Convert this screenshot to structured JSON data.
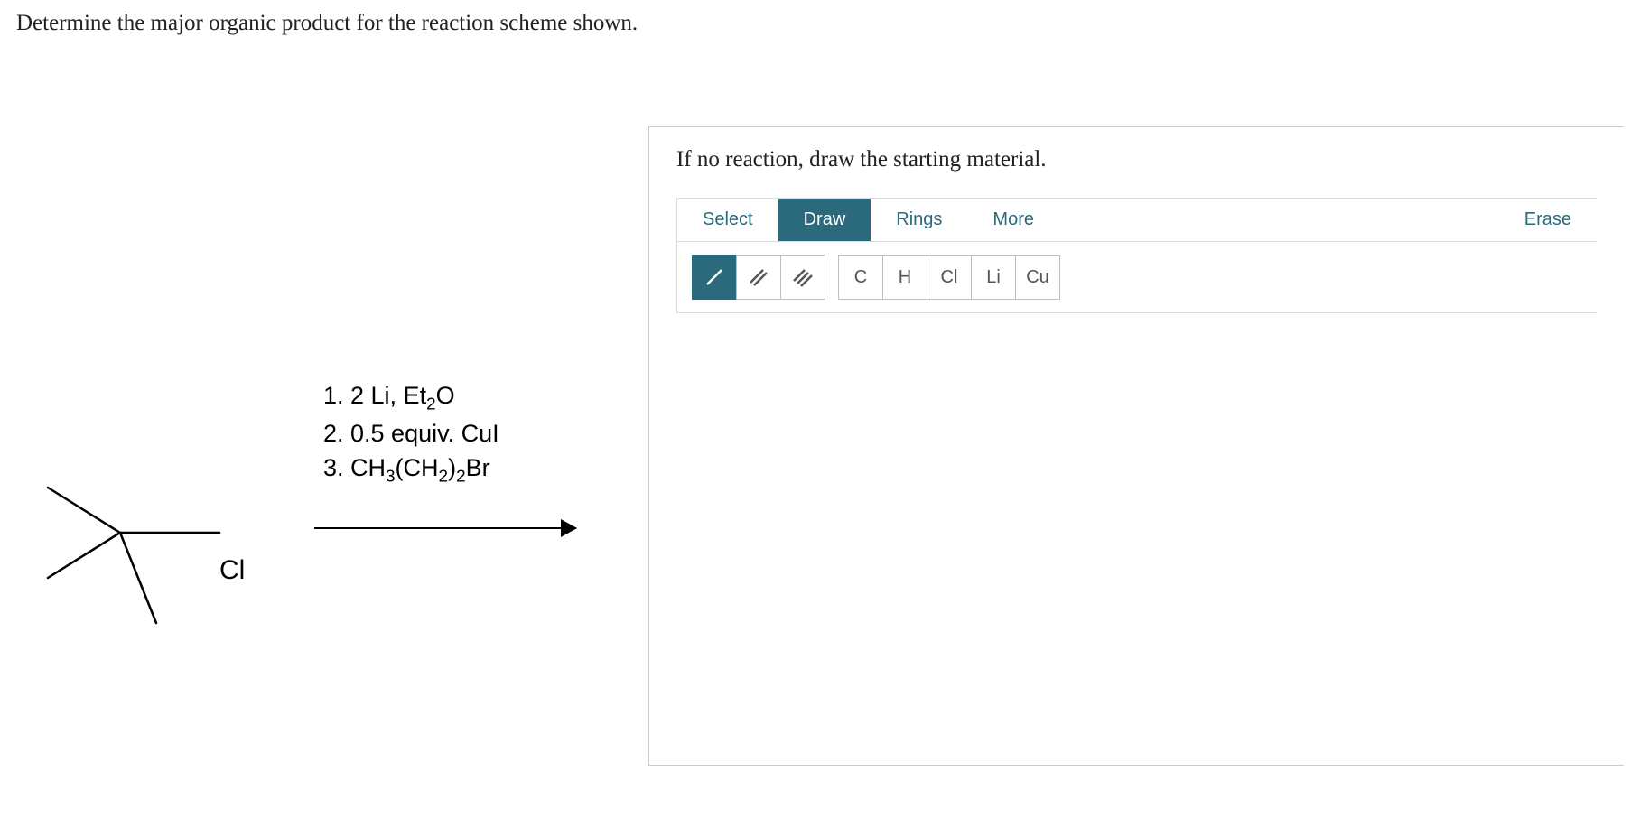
{
  "question": "Determine the major organic product for the reaction scheme shown.",
  "instruction": "If no reaction, draw the starting material.",
  "toolbar": {
    "tabs": {
      "select": "Select",
      "draw": "Draw",
      "rings": "Rings",
      "more": "More",
      "erase": "Erase"
    },
    "bonds": {
      "single": "/",
      "double": "//",
      "triple": "///"
    },
    "elements": {
      "c": "C",
      "h": "H",
      "cl": "Cl",
      "li": "Li",
      "cu": "Cu"
    }
  },
  "scheme": {
    "reagents": {
      "step1_prefix": "1. 2 Li, Et",
      "step1_sub": "2",
      "step1_suffix": "O",
      "step2": "2. 0.5 equiv. CuI",
      "step3_prefix": "3. CH",
      "step3_sub1": "3",
      "step3_mid": "(CH",
      "step3_sub2": "2",
      "step3_close": ")",
      "step3_sub3": "2",
      "step3_suffix": "Br"
    },
    "substituent": "Cl"
  }
}
